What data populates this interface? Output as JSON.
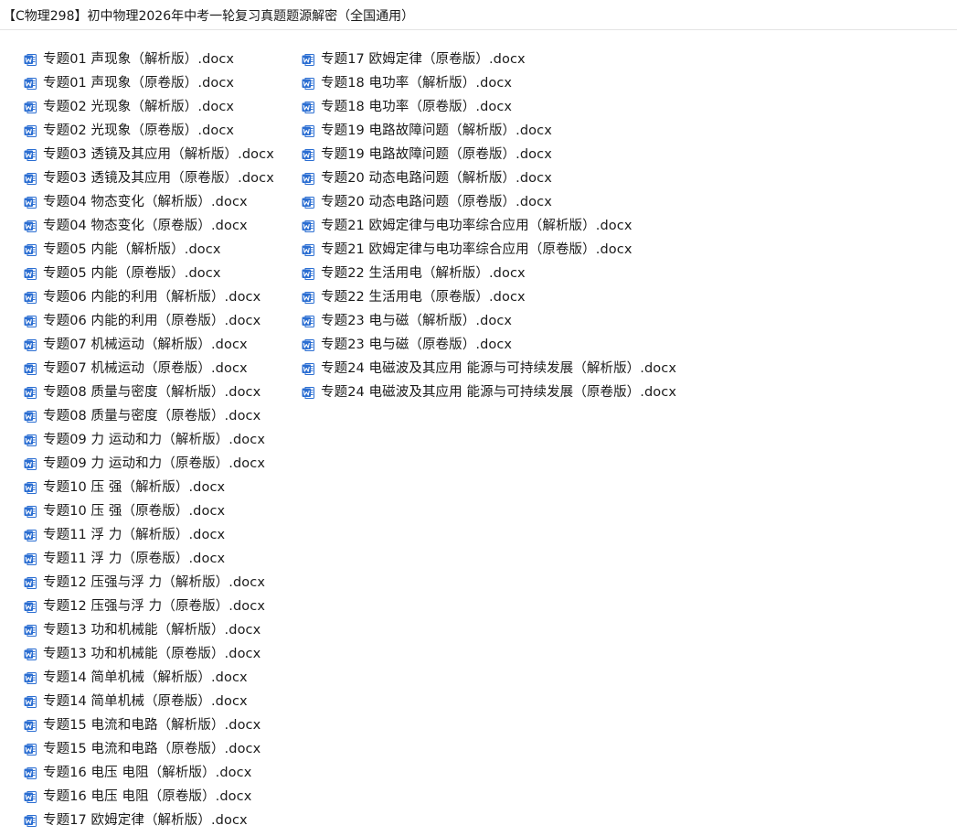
{
  "window": {
    "title": "【C物理298】初中物理2026年中考一轮复习真题题源解密（全国通用）"
  },
  "icons": {
    "file_icon": "word-document-icon",
    "file_icon_color": "#2b6ed2"
  },
  "files": {
    "left": [
      {
        "name": "专题01 声现象（解析版）.docx"
      },
      {
        "name": "专题01 声现象（原卷版）.docx"
      },
      {
        "name": "专题02 光现象（解析版）.docx"
      },
      {
        "name": "专题02 光现象（原卷版）.docx"
      },
      {
        "name": "专题03 透镜及其应用（解析版）.docx"
      },
      {
        "name": "专题03 透镜及其应用（原卷版）.docx"
      },
      {
        "name": "专题04 物态变化（解析版）.docx"
      },
      {
        "name": "专题04 物态变化（原卷版）.docx"
      },
      {
        "name": "专题05 内能（解析版）.docx"
      },
      {
        "name": "专题05 内能（原卷版）.docx"
      },
      {
        "name": "专题06 内能的利用（解析版）.docx"
      },
      {
        "name": "专题06 内能的利用（原卷版）.docx"
      },
      {
        "name": "专题07 机械运动（解析版）.docx"
      },
      {
        "name": "专题07 机械运动（原卷版）.docx"
      },
      {
        "name": "专题08 质量与密度（解析版）.docx"
      },
      {
        "name": "专题08 质量与密度（原卷版）.docx"
      },
      {
        "name": "专题09 力 运动和力（解析版）.docx"
      },
      {
        "name": "专题09 力 运动和力（原卷版）.docx"
      },
      {
        "name": "专题10 压 强（解析版）.docx"
      },
      {
        "name": "专题10 压 强（原卷版）.docx"
      },
      {
        "name": "专题11 浮 力（解析版）.docx"
      },
      {
        "name": "专题11 浮 力（原卷版）.docx"
      },
      {
        "name": "专题12 压强与浮 力（解析版）.docx"
      },
      {
        "name": "专题12 压强与浮 力（原卷版）.docx"
      },
      {
        "name": "专题13 功和机械能（解析版）.docx"
      },
      {
        "name": "专题13 功和机械能（原卷版）.docx"
      },
      {
        "name": "专题14 简单机械（解析版）.docx"
      },
      {
        "name": "专题14 简单机械（原卷版）.docx"
      },
      {
        "name": "专题15 电流和电路（解析版）.docx"
      },
      {
        "name": "专题15 电流和电路（原卷版）.docx"
      },
      {
        "name": "专题16 电压 电阻（解析版）.docx"
      },
      {
        "name": "专题16 电压 电阻（原卷版）.docx"
      },
      {
        "name": "专题17 欧姆定律（解析版）.docx"
      }
    ],
    "right": [
      {
        "name": "专题17 欧姆定律（原卷版）.docx"
      },
      {
        "name": "专题18 电功率（解析版）.docx"
      },
      {
        "name": "专题18 电功率（原卷版）.docx"
      },
      {
        "name": "专题19 电路故障问题（解析版）.docx"
      },
      {
        "name": "专题19 电路故障问题（原卷版）.docx"
      },
      {
        "name": "专题20 动态电路问题（解析版）.docx"
      },
      {
        "name": "专题20 动态电路问题（原卷版）.docx"
      },
      {
        "name": "专题21 欧姆定律与电功率综合应用（解析版）.docx"
      },
      {
        "name": "专题21 欧姆定律与电功率综合应用（原卷版）.docx"
      },
      {
        "name": "专题22 生活用电（解析版）.docx"
      },
      {
        "name": "专题22 生活用电（原卷版）.docx"
      },
      {
        "name": "专题23 电与磁（解析版）.docx"
      },
      {
        "name": "专题23 电与磁（原卷版）.docx"
      },
      {
        "name": "专题24 电磁波及其应用 能源与可持续发展（解析版）.docx"
      },
      {
        "name": "专题24 电磁波及其应用 能源与可持续发展（原卷版）.docx"
      }
    ]
  }
}
